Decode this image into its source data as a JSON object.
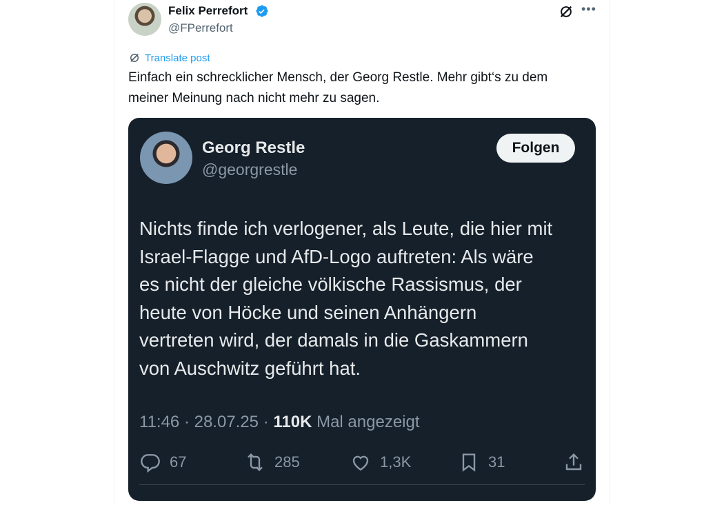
{
  "post": {
    "author_name": "Felix Perrefort",
    "author_handle": "@FPerrefort",
    "translate_label": "Translate post",
    "text_line1": "Einfach ein schrecklicher Mensch, der Georg Restle. Mehr gibt‘s zu dem",
    "text_line2": "meiner Meinung nach nicht mehr zu sagen."
  },
  "quoted": {
    "author_name": "Georg Restle",
    "author_handle": "@georgrestle",
    "follow_label": "Folgen",
    "text_lines": [
      "Nichts finde ich verlogener, als Leute, die hier mit",
      "Israel-Flagge und AfD-Logo auftreten: Als wäre",
      "es nicht der gleiche völkische Rassismus, der",
      "heute von Höcke und seinen Anhängern",
      "vertreten wird, der damals in die Gaskammern",
      "von Auschwitz geführt hat."
    ],
    "timestamp": "11:46 · 28.07.25 · ",
    "views": "110K",
    "views_label": " Mal angezeigt",
    "replies": "67",
    "reposts": "285",
    "likes": "1,3K",
    "bookmarks": "31"
  },
  "colors": {
    "accent": "#1d9bf0",
    "card_bg": "#15202b",
    "muted": "#8b98a5"
  },
  "icons": [
    "verified-badge-icon",
    "grok-icon",
    "more-icon",
    "translate-icon",
    "reply-icon",
    "repost-icon",
    "like-icon",
    "bookmark-icon",
    "share-icon"
  ]
}
